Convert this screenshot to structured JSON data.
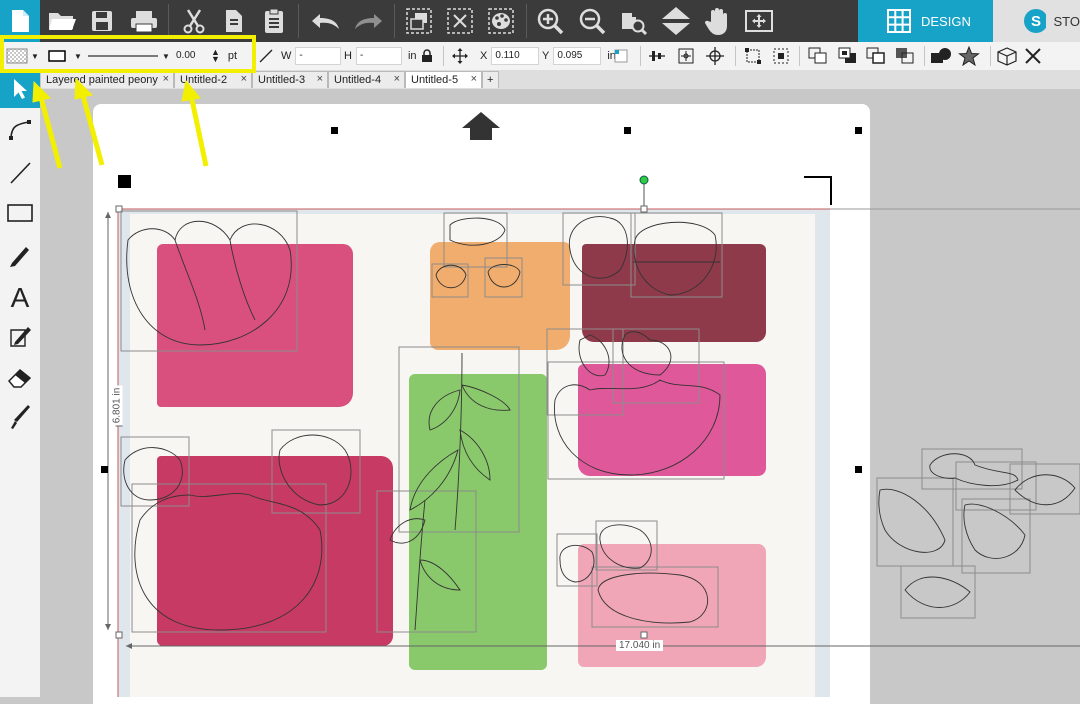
{
  "app_tabs": {
    "design": "DESIGN",
    "store": "STO"
  },
  "toolbar": {
    "icons": [
      "new-document",
      "open",
      "save",
      "print",
      "cut",
      "copy",
      "paste",
      "undo",
      "redo",
      "group",
      "ungroup",
      "replicate",
      "zoom-in",
      "zoom-out",
      "zoom-to-fit",
      "move-down",
      "pan",
      "fit-to-page"
    ]
  },
  "properties": {
    "line_width_value": "0.00",
    "line_width_unit": "pt",
    "w_label": "W",
    "w_value": "-",
    "h_label": "H",
    "h_value": "-",
    "size_unit": "in",
    "x_label": "X",
    "x_value": "0.110",
    "y_label": "Y",
    "y_value": "0.095",
    "pos_unit": "in"
  },
  "doc_tabs": [
    {
      "label": "Layered painted peony",
      "active": false
    },
    {
      "label": "Untitled-2",
      "active": false
    },
    {
      "label": "Untitled-3",
      "active": false
    },
    {
      "label": "Untitled-4",
      "active": false
    },
    {
      "label": "Untitled-5",
      "active": true
    }
  ],
  "doc_tab_close": "×",
  "doc_tab_add": "+",
  "dimensions": {
    "height": "6.801 in",
    "width": "17.040 in"
  },
  "colors": {
    "accent": "#17a2c7",
    "toolbar_dark": "#3b3b3b",
    "highlight": "#f2f000",
    "paint_pink": "#d84d7d",
    "paint_crimson": "#c43660",
    "paint_orange": "#f0a35c",
    "paint_maroon": "#8e3948",
    "paint_magenta": "#e0569a",
    "paint_green": "#86c46a",
    "paint_light_pink": "#f0a4b4"
  }
}
